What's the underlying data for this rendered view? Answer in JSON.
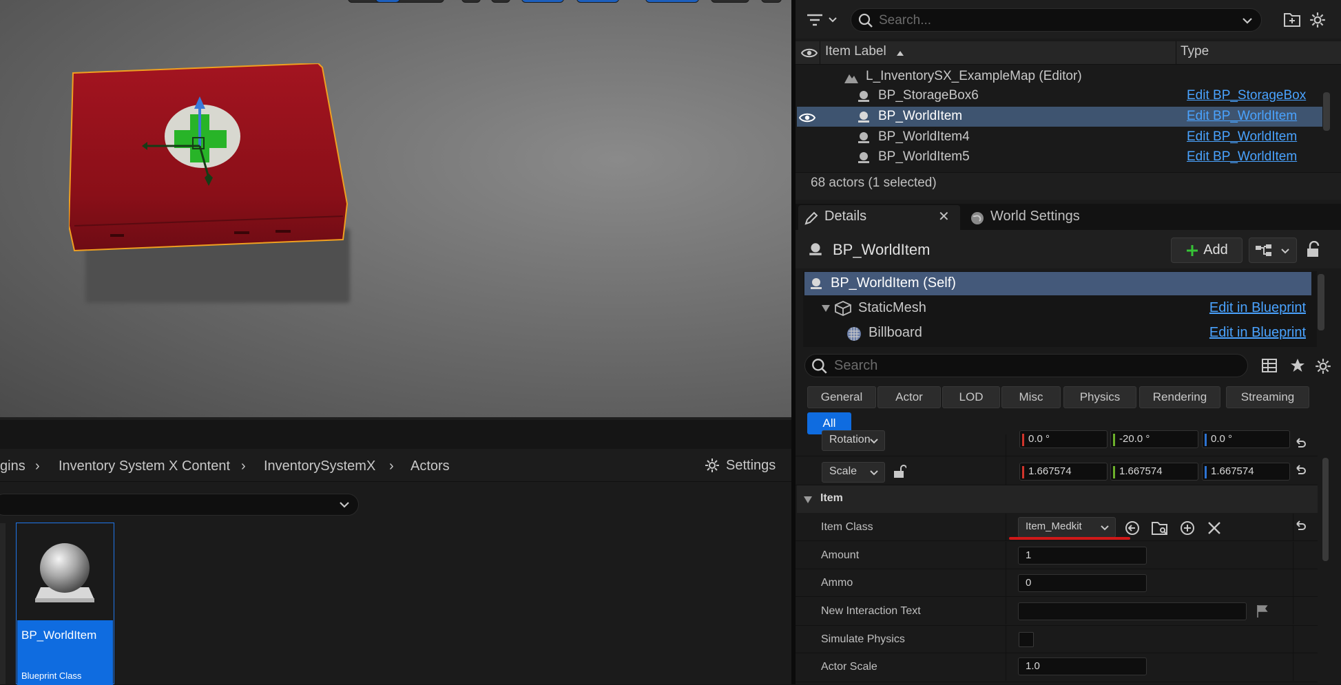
{
  "outliner": {
    "search_placeholder": "Search...",
    "columns": {
      "label": "Item Label",
      "type": "Type"
    },
    "rows": [
      {
        "label": "L_InventorySX_ExampleMap (Editor)",
        "type": ""
      },
      {
        "label": "BP_StorageBox6",
        "type": "Edit BP_StorageBox"
      },
      {
        "label": "BP_WorldItem",
        "type": "Edit BP_WorldItem",
        "selected": true
      },
      {
        "label": "BP_WorldItem4",
        "type": "Edit BP_WorldItem"
      },
      {
        "label": "BP_WorldItem5",
        "type": "Edit BP_WorldItem"
      }
    ],
    "actor_count": "68 actors (1 selected)"
  },
  "tabs": {
    "details": "Details",
    "world_settings": "World Settings"
  },
  "details": {
    "actor_name": "BP_WorldItem",
    "add_label": "Add",
    "components": [
      {
        "label": "BP_WorldItem (Self)",
        "link": ""
      },
      {
        "label": "StaticMesh",
        "link": "Edit in Blueprint"
      },
      {
        "label": "Billboard",
        "link": "Edit in Blueprint"
      }
    ],
    "search_placeholder": "Search",
    "categories": [
      "General",
      "Actor",
      "LOD",
      "Misc",
      "Physics",
      "Rendering",
      "Streaming",
      "All"
    ],
    "active_category": "All",
    "transform": {
      "rotation_label": "Rotation",
      "rotation": [
        "0.0 °",
        "-20.0 °",
        "0.0 °"
      ],
      "scale_label": "Scale",
      "scale": [
        "1.667574",
        "1.667574",
        "1.667574"
      ]
    },
    "item_section": "Item",
    "item_properties": {
      "item_class_label": "Item Class",
      "item_class_value": "Item_Medkit",
      "amount_label": "Amount",
      "amount_value": "1",
      "ammo_label": "Ammo",
      "ammo_value": "0",
      "interaction_label": "New Interaction Text",
      "interaction_value": "",
      "simulate_label": "Simulate Physics",
      "simulate_checked": false,
      "actor_scale_label": "Actor Scale",
      "actor_scale_value": "1.0"
    }
  },
  "content_browser": {
    "breadcrumbs": [
      "gins",
      "Inventory System X Content",
      "InventorySystemX",
      "Actors"
    ],
    "settings_label": "Settings",
    "asset": {
      "name": "BP_WorldItem",
      "type": "Blueprint Class"
    }
  },
  "colors": {
    "accent": "#0f6ce0",
    "selection_row": "#3e5470",
    "link": "#4aa3ff",
    "axis_x": "#d0342c",
    "axis_y": "#6cb02c",
    "axis_z": "#2c73d2",
    "highlight_underline": "#d01818",
    "medkit_red": "#a0141e",
    "selection_outline": "#f0a020"
  },
  "icons": [
    "filter-icon",
    "search-icon",
    "add-folder-icon",
    "gear-icon",
    "eye-icon",
    "level-icon",
    "actor-icon",
    "pencil-icon",
    "close-icon",
    "globe-icon",
    "plus-icon",
    "blueprint-icon",
    "lock-icon",
    "table-icon",
    "star-icon",
    "chevron-down-icon",
    "reset-icon",
    "flag-icon",
    "browse-icon",
    "clear-icon"
  ]
}
